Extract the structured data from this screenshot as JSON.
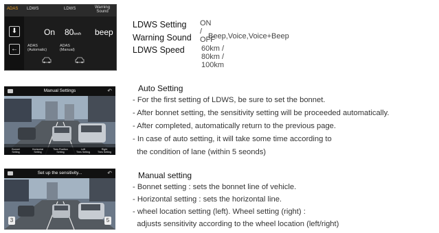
{
  "adas_panel": {
    "tab_adas": "ADAS",
    "tab_ldws_1": "LDWS",
    "tab_ldws_2": "LDWS",
    "tab_warning_line1": "Warning",
    "tab_warning_line2": "Sound",
    "value_on": "On",
    "value_speed_num": "80",
    "value_speed_unit": "km/h",
    "value_beep": "beep",
    "sub_auto_line1": "ADAS",
    "sub_auto_line2": "(Automatic)",
    "sub_manual_line1": "ADAS",
    "sub_manual_line2": "(Manual)",
    "button_down_icon": "download-arrow-icon",
    "button_back_icon": "back-arrow-icon"
  },
  "ldws_info": {
    "setting_label": "LDWS Setting",
    "setting_value": "ON / OFF",
    "sound_label": "Warning Sound",
    "sound_value": "Beep,Voice,Voice+Beep",
    "speed_label": "LDWS Speed",
    "speed_value": "60km / 80km / 100km"
  },
  "manual_panel": {
    "title": "Manual Settings",
    "tabs": [
      "Bonnet\nSetting",
      "Horizontal\nSetting",
      "Tires Position\nSetting",
      "Left\nTires Setting",
      "Right\nTires Setting"
    ]
  },
  "sensitivity_panel": {
    "title": "Set up the sensitivity...",
    "left_value": "3",
    "right_value": "5"
  },
  "auto_setting": {
    "heading": "Auto Setting",
    "lines": [
      "- For the first setting of LDWS, be sure to set the bonnet.",
      "- After bonnet setting, the sensitivity setting will be proceeded automatically.",
      "- After completed, automatically return to the previous page.",
      "- In case of auto setting, it will take some time according to",
      "  the condition of lane (within 5 seonds)"
    ]
  },
  "manual_setting": {
    "heading": "Manual setting",
    "lines": [
      "- Bonnet setting : sets the bonnet line of vehicle.",
      "- Horizontal setting : sets the horizontal line.",
      "- wheel location setting (left). Wheel setting (right) :",
      "  adjusts sensitivity according to the wheel location (left/right)"
    ]
  },
  "colors": {
    "adas_accent": "#f0a020",
    "panel_bg": "#1c1c1c"
  }
}
